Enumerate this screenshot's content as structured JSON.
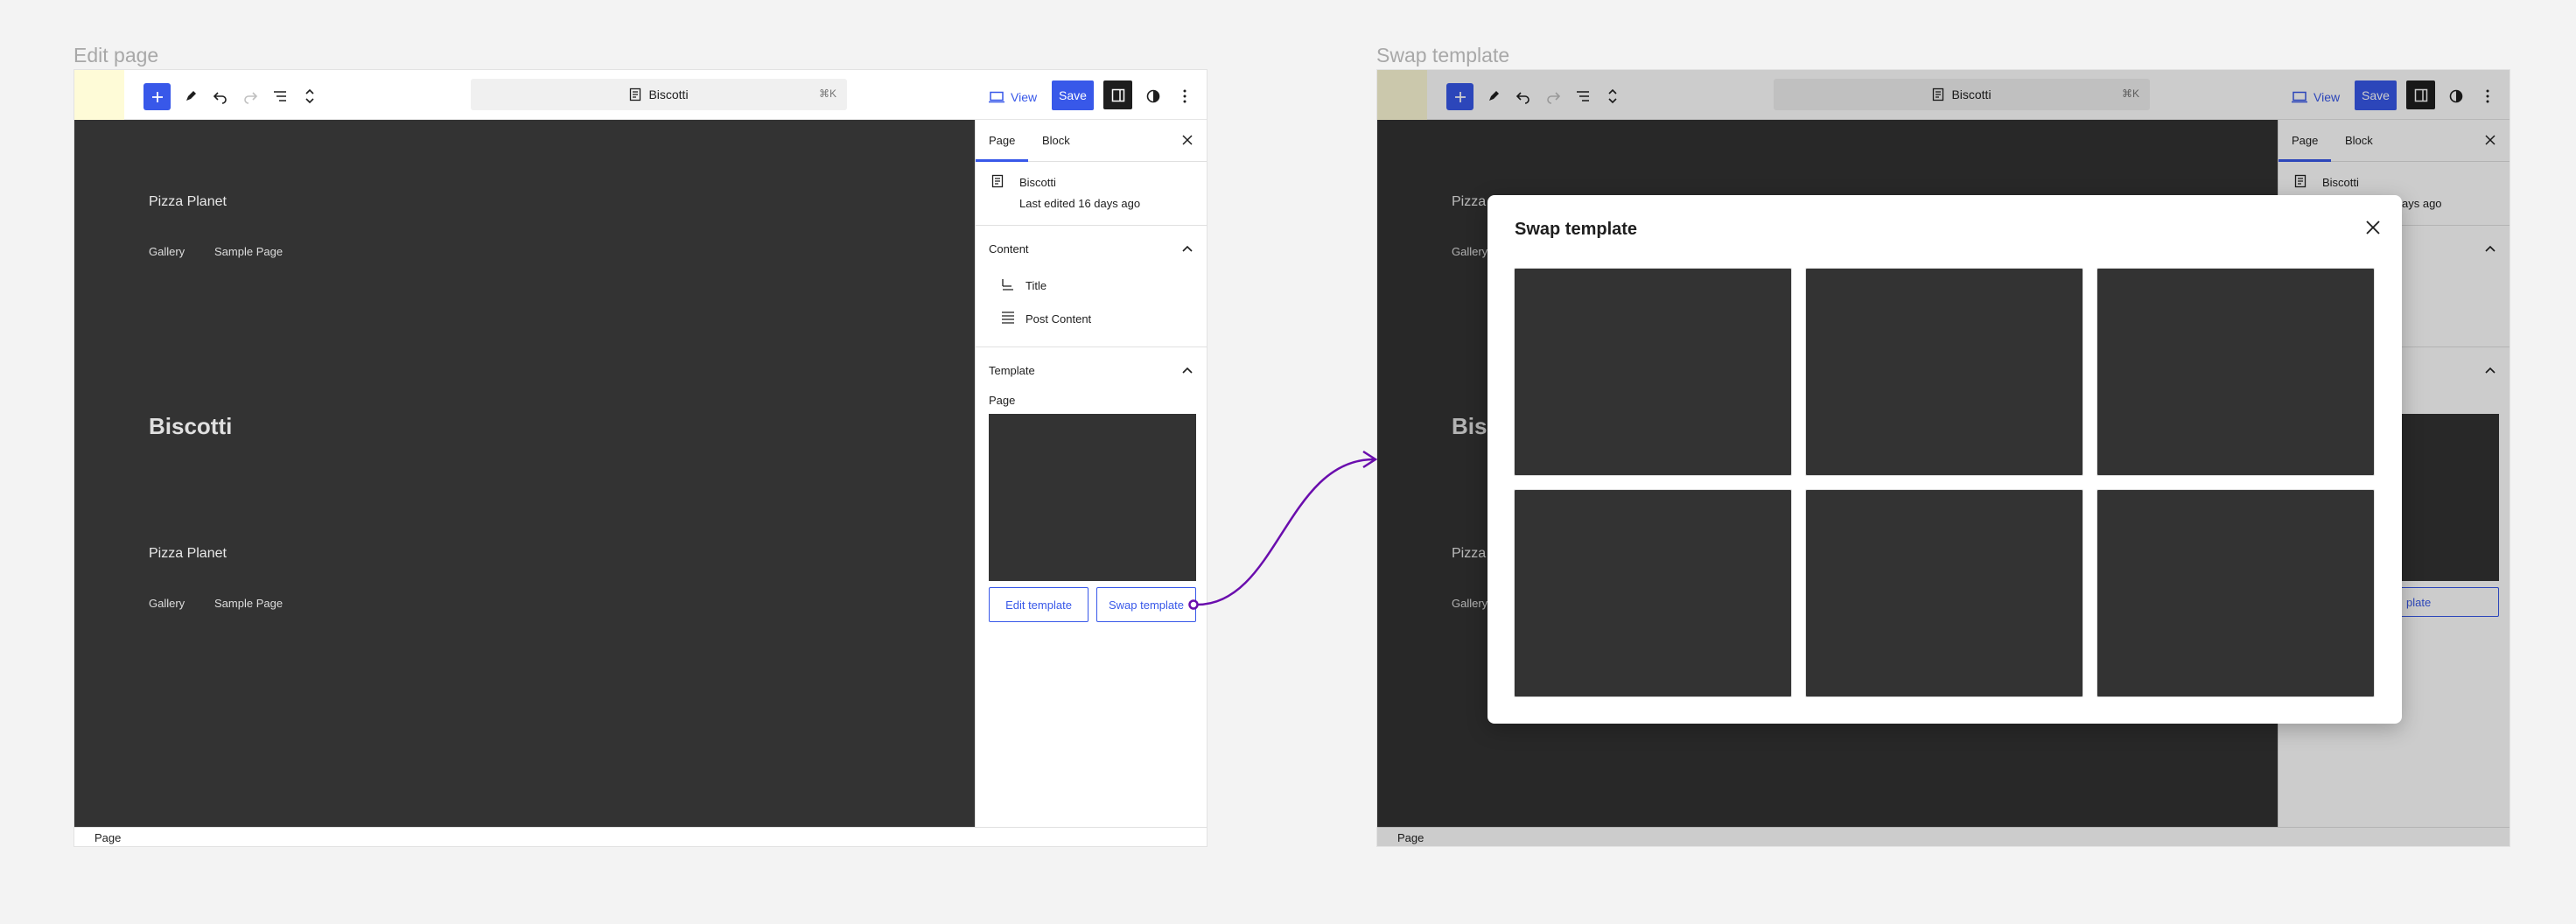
{
  "captions": {
    "left": "Edit page",
    "right": "Swap template"
  },
  "editor": {
    "command_title": "Biscotti",
    "command_shortcut": "⌘K",
    "view_label": "View",
    "save_label": "Save",
    "canvas": {
      "site_title": "Pizza Planet",
      "nav": [
        "Gallery",
        "Sample Page"
      ],
      "post_title": "Biscotti"
    },
    "sidebar": {
      "tabs": [
        "Page",
        "Block"
      ],
      "page_title": "Biscotti",
      "last_edited": "Last edited 16 days ago",
      "content_heading": "Content",
      "content_items": [
        "Title",
        "Post Content"
      ],
      "template_heading": "Template",
      "template_name": "Page",
      "edit_template": "Edit template",
      "swap_template": "Swap template",
      "swap_template_partial": "plate",
      "last_edited_partial": "ays ago"
    },
    "status": "Page"
  },
  "modal": {
    "title": "Swap template",
    "template_count": 6
  },
  "colors": {
    "accent": "#3858e9",
    "canvas": "#333333",
    "arrow": "#6a0dad"
  },
  "icons": [
    "plus-icon",
    "pen-icon",
    "undo-icon",
    "redo-icon",
    "list-view-icon",
    "chevron-up-down-icon",
    "page-icon",
    "desktop-icon",
    "sidebar-icon",
    "contrast-icon",
    "more-vertical-icon",
    "close-icon",
    "chevron-up-icon",
    "title-icon",
    "paragraph-icon"
  ]
}
